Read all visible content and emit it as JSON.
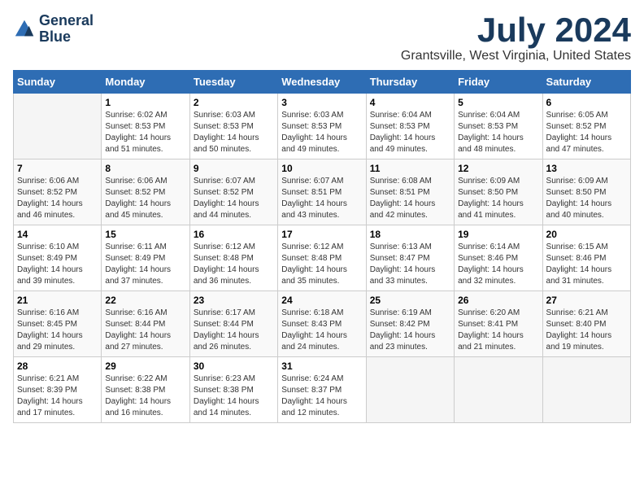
{
  "header": {
    "logo_line1": "General",
    "logo_line2": "Blue",
    "month_title": "July 2024",
    "location": "Grantsville, West Virginia, United States"
  },
  "weekdays": [
    "Sunday",
    "Monday",
    "Tuesday",
    "Wednesday",
    "Thursday",
    "Friday",
    "Saturday"
  ],
  "weeks": [
    [
      {
        "day": "",
        "sunrise": "",
        "sunset": "",
        "daylight": ""
      },
      {
        "day": "1",
        "sunrise": "Sunrise: 6:02 AM",
        "sunset": "Sunset: 8:53 PM",
        "daylight": "Daylight: 14 hours and 51 minutes."
      },
      {
        "day": "2",
        "sunrise": "Sunrise: 6:03 AM",
        "sunset": "Sunset: 8:53 PM",
        "daylight": "Daylight: 14 hours and 50 minutes."
      },
      {
        "day": "3",
        "sunrise": "Sunrise: 6:03 AM",
        "sunset": "Sunset: 8:53 PM",
        "daylight": "Daylight: 14 hours and 49 minutes."
      },
      {
        "day": "4",
        "sunrise": "Sunrise: 6:04 AM",
        "sunset": "Sunset: 8:53 PM",
        "daylight": "Daylight: 14 hours and 49 minutes."
      },
      {
        "day": "5",
        "sunrise": "Sunrise: 6:04 AM",
        "sunset": "Sunset: 8:53 PM",
        "daylight": "Daylight: 14 hours and 48 minutes."
      },
      {
        "day": "6",
        "sunrise": "Sunrise: 6:05 AM",
        "sunset": "Sunset: 8:52 PM",
        "daylight": "Daylight: 14 hours and 47 minutes."
      }
    ],
    [
      {
        "day": "7",
        "sunrise": "Sunrise: 6:06 AM",
        "sunset": "Sunset: 8:52 PM",
        "daylight": "Daylight: 14 hours and 46 minutes."
      },
      {
        "day": "8",
        "sunrise": "Sunrise: 6:06 AM",
        "sunset": "Sunset: 8:52 PM",
        "daylight": "Daylight: 14 hours and 45 minutes."
      },
      {
        "day": "9",
        "sunrise": "Sunrise: 6:07 AM",
        "sunset": "Sunset: 8:52 PM",
        "daylight": "Daylight: 14 hours and 44 minutes."
      },
      {
        "day": "10",
        "sunrise": "Sunrise: 6:07 AM",
        "sunset": "Sunset: 8:51 PM",
        "daylight": "Daylight: 14 hours and 43 minutes."
      },
      {
        "day": "11",
        "sunrise": "Sunrise: 6:08 AM",
        "sunset": "Sunset: 8:51 PM",
        "daylight": "Daylight: 14 hours and 42 minutes."
      },
      {
        "day": "12",
        "sunrise": "Sunrise: 6:09 AM",
        "sunset": "Sunset: 8:50 PM",
        "daylight": "Daylight: 14 hours and 41 minutes."
      },
      {
        "day": "13",
        "sunrise": "Sunrise: 6:09 AM",
        "sunset": "Sunset: 8:50 PM",
        "daylight": "Daylight: 14 hours and 40 minutes."
      }
    ],
    [
      {
        "day": "14",
        "sunrise": "Sunrise: 6:10 AM",
        "sunset": "Sunset: 8:49 PM",
        "daylight": "Daylight: 14 hours and 39 minutes."
      },
      {
        "day": "15",
        "sunrise": "Sunrise: 6:11 AM",
        "sunset": "Sunset: 8:49 PM",
        "daylight": "Daylight: 14 hours and 37 minutes."
      },
      {
        "day": "16",
        "sunrise": "Sunrise: 6:12 AM",
        "sunset": "Sunset: 8:48 PM",
        "daylight": "Daylight: 14 hours and 36 minutes."
      },
      {
        "day": "17",
        "sunrise": "Sunrise: 6:12 AM",
        "sunset": "Sunset: 8:48 PM",
        "daylight": "Daylight: 14 hours and 35 minutes."
      },
      {
        "day": "18",
        "sunrise": "Sunrise: 6:13 AM",
        "sunset": "Sunset: 8:47 PM",
        "daylight": "Daylight: 14 hours and 33 minutes."
      },
      {
        "day": "19",
        "sunrise": "Sunrise: 6:14 AM",
        "sunset": "Sunset: 8:46 PM",
        "daylight": "Daylight: 14 hours and 32 minutes."
      },
      {
        "day": "20",
        "sunrise": "Sunrise: 6:15 AM",
        "sunset": "Sunset: 8:46 PM",
        "daylight": "Daylight: 14 hours and 31 minutes."
      }
    ],
    [
      {
        "day": "21",
        "sunrise": "Sunrise: 6:16 AM",
        "sunset": "Sunset: 8:45 PM",
        "daylight": "Daylight: 14 hours and 29 minutes."
      },
      {
        "day": "22",
        "sunrise": "Sunrise: 6:16 AM",
        "sunset": "Sunset: 8:44 PM",
        "daylight": "Daylight: 14 hours and 27 minutes."
      },
      {
        "day": "23",
        "sunrise": "Sunrise: 6:17 AM",
        "sunset": "Sunset: 8:44 PM",
        "daylight": "Daylight: 14 hours and 26 minutes."
      },
      {
        "day": "24",
        "sunrise": "Sunrise: 6:18 AM",
        "sunset": "Sunset: 8:43 PM",
        "daylight": "Daylight: 14 hours and 24 minutes."
      },
      {
        "day": "25",
        "sunrise": "Sunrise: 6:19 AM",
        "sunset": "Sunset: 8:42 PM",
        "daylight": "Daylight: 14 hours and 23 minutes."
      },
      {
        "day": "26",
        "sunrise": "Sunrise: 6:20 AM",
        "sunset": "Sunset: 8:41 PM",
        "daylight": "Daylight: 14 hours and 21 minutes."
      },
      {
        "day": "27",
        "sunrise": "Sunrise: 6:21 AM",
        "sunset": "Sunset: 8:40 PM",
        "daylight": "Daylight: 14 hours and 19 minutes."
      }
    ],
    [
      {
        "day": "28",
        "sunrise": "Sunrise: 6:21 AM",
        "sunset": "Sunset: 8:39 PM",
        "daylight": "Daylight: 14 hours and 17 minutes."
      },
      {
        "day": "29",
        "sunrise": "Sunrise: 6:22 AM",
        "sunset": "Sunset: 8:38 PM",
        "daylight": "Daylight: 14 hours and 16 minutes."
      },
      {
        "day": "30",
        "sunrise": "Sunrise: 6:23 AM",
        "sunset": "Sunset: 8:38 PM",
        "daylight": "Daylight: 14 hours and 14 minutes."
      },
      {
        "day": "31",
        "sunrise": "Sunrise: 6:24 AM",
        "sunset": "Sunset: 8:37 PM",
        "daylight": "Daylight: 14 hours and 12 minutes."
      },
      {
        "day": "",
        "sunrise": "",
        "sunset": "",
        "daylight": ""
      },
      {
        "day": "",
        "sunrise": "",
        "sunset": "",
        "daylight": ""
      },
      {
        "day": "",
        "sunrise": "",
        "sunset": "",
        "daylight": ""
      }
    ]
  ]
}
